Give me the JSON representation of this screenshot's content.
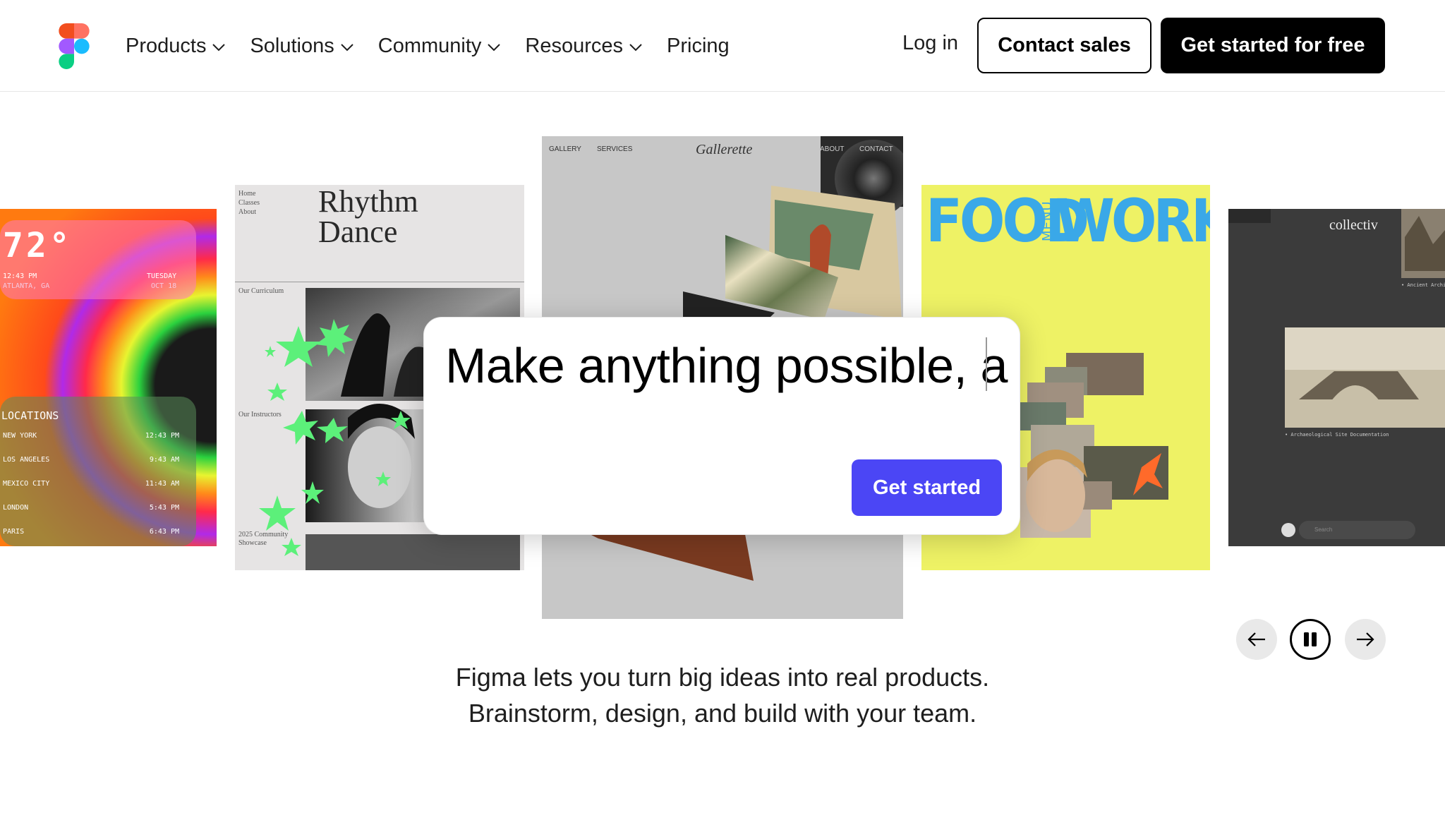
{
  "nav": {
    "links": [
      {
        "label": "Products"
      },
      {
        "label": "Solutions"
      },
      {
        "label": "Community"
      },
      {
        "label": "Resources"
      },
      {
        "label": "Pricing"
      }
    ],
    "login": "Log in",
    "contact": "Contact sales",
    "cta": "Get started for free"
  },
  "hero": {
    "prompt_text": "Make anything possible, a",
    "button": "Get started",
    "tagline_line1": "Figma lets you turn big ideas into real products.",
    "tagline_line2": "Brainstorm, design, and build with your team."
  },
  "cards": {
    "weather": {
      "big": "72°",
      "time": "12:43 PM",
      "city": "ATLANTA, GA",
      "day": "TUESDAY",
      "date": "OCT 18",
      "locations_title": "LOCATIONS",
      "rows": [
        {
          "city": "NEW YORK",
          "time": "12:43 PM"
        },
        {
          "city": "LOS ANGELES",
          "time": "9:43 AM"
        },
        {
          "city": "MEXICO CITY",
          "time": "11:43 AM"
        },
        {
          "city": "LONDON",
          "time": "5:43 PM"
        },
        {
          "city": "PARIS",
          "time": "6:43 PM"
        }
      ]
    },
    "rhythm": {
      "menu": [
        "Home",
        "Classes",
        "About"
      ],
      "title1": "Rhythm",
      "title2": "Dance",
      "curriculum": "Our Curriculum",
      "instructors": "Our Instructors",
      "showcase": "2025 Community Showcase"
    },
    "gallery": {
      "nav1": "GALLERY",
      "nav2": "SERVICES",
      "logo": "Gallerette",
      "nav3": "ABOUT",
      "nav4": "CONTACT"
    },
    "food": {
      "word1": "FOOD",
      "menu": "MENU",
      "word2": "WORKS"
    },
    "collectiv": {
      "logo": "collectiv",
      "caption1": "• Ancient Architecture",
      "caption2": "• Archaeological Site Documentation",
      "search": "Search"
    }
  },
  "colors": {
    "accent": "#4b46f5",
    "food_bg": "#eef265",
    "food_text": "#3aa8e8"
  },
  "icons": [
    "figma-logo-icon",
    "chevron-down-icon",
    "arrow-left-icon",
    "pause-icon",
    "arrow-right-icon"
  ]
}
